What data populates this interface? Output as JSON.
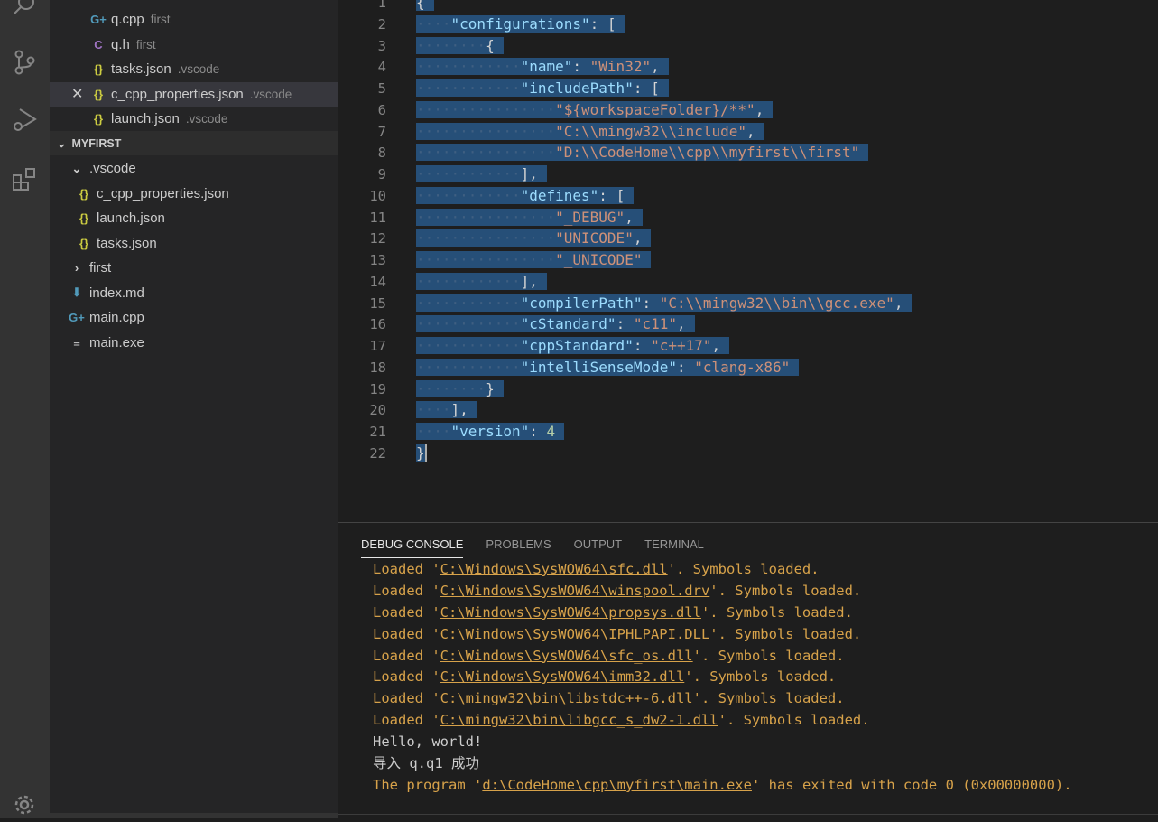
{
  "sidebar": {
    "open_editors": [
      {
        "name": "q.cpp",
        "desc": "first",
        "icon": "cpp-icon"
      },
      {
        "name": "q.h",
        "desc": "first",
        "icon": "c-header-icon"
      },
      {
        "name": "tasks.json",
        "desc": ".vscode",
        "icon": "json-icon"
      },
      {
        "name": "c_cpp_properties.json",
        "desc": ".vscode",
        "icon": "json-icon",
        "active": true
      },
      {
        "name": "launch.json",
        "desc": ".vscode",
        "icon": "json-icon"
      }
    ],
    "folder_title": "MYFIRST",
    "tree": [
      {
        "name": ".vscode",
        "type": "folder-open"
      },
      {
        "name": "c_cpp_properties.json",
        "type": "json"
      },
      {
        "name": "launch.json",
        "type": "json"
      },
      {
        "name": "tasks.json",
        "type": "json"
      },
      {
        "name": "first",
        "type": "folder-closed"
      },
      {
        "name": "index.md",
        "type": "markdown"
      },
      {
        "name": "main.cpp",
        "type": "cpp"
      },
      {
        "name": "main.exe",
        "type": "file"
      }
    ]
  },
  "editor": {
    "lines": [
      {
        "n": "1",
        "i": 0,
        "t": [
          [
            "p",
            "{"
          ]
        ]
      },
      {
        "n": "2",
        "i": 4,
        "t": [
          [
            "k",
            "\"configurations\""
          ],
          [
            "p",
            ": ["
          ]
        ]
      },
      {
        "n": "3",
        "i": 8,
        "t": [
          [
            "p",
            "{"
          ]
        ]
      },
      {
        "n": "4",
        "i": 12,
        "t": [
          [
            "k",
            "\"name\""
          ],
          [
            "p",
            ": "
          ],
          [
            "s",
            "\"Win32\""
          ],
          [
            "p",
            ","
          ]
        ]
      },
      {
        "n": "5",
        "i": 12,
        "t": [
          [
            "k",
            "\"includePath\""
          ],
          [
            "p",
            ": ["
          ]
        ]
      },
      {
        "n": "6",
        "i": 16,
        "t": [
          [
            "s",
            "\"${workspaceFolder}/**\""
          ],
          [
            "p",
            ","
          ]
        ]
      },
      {
        "n": "7",
        "i": 16,
        "t": [
          [
            "s",
            "\"C:\\\\mingw32\\\\include\""
          ],
          [
            "p",
            ","
          ]
        ]
      },
      {
        "n": "8",
        "i": 16,
        "t": [
          [
            "s",
            "\"D:\\\\CodeHome\\\\cpp\\\\myfirst\\\\first\""
          ]
        ]
      },
      {
        "n": "9",
        "i": 12,
        "t": [
          [
            "p",
            "],"
          ]
        ]
      },
      {
        "n": "10",
        "i": 12,
        "t": [
          [
            "k",
            "\"defines\""
          ],
          [
            "p",
            ": ["
          ]
        ]
      },
      {
        "n": "11",
        "i": 16,
        "t": [
          [
            "s",
            "\"_DEBUG\""
          ],
          [
            "p",
            ","
          ]
        ]
      },
      {
        "n": "12",
        "i": 16,
        "t": [
          [
            "s",
            "\"UNICODE\""
          ],
          [
            "p",
            ","
          ]
        ]
      },
      {
        "n": "13",
        "i": 16,
        "t": [
          [
            "s",
            "\"_UNICODE\""
          ]
        ]
      },
      {
        "n": "14",
        "i": 12,
        "t": [
          [
            "p",
            "],"
          ]
        ]
      },
      {
        "n": "15",
        "i": 12,
        "t": [
          [
            "k",
            "\"compilerPath\""
          ],
          [
            "p",
            ": "
          ],
          [
            "s",
            "\"C:\\\\mingw32\\\\bin\\\\gcc.exe\""
          ],
          [
            "p",
            ","
          ]
        ]
      },
      {
        "n": "16",
        "i": 12,
        "t": [
          [
            "k",
            "\"cStandard\""
          ],
          [
            "p",
            ": "
          ],
          [
            "s",
            "\"c11\""
          ],
          [
            "p",
            ","
          ]
        ]
      },
      {
        "n": "17",
        "i": 12,
        "t": [
          [
            "k",
            "\"cppStandard\""
          ],
          [
            "p",
            ": "
          ],
          [
            "s",
            "\"c++17\""
          ],
          [
            "p",
            ","
          ]
        ]
      },
      {
        "n": "18",
        "i": 12,
        "t": [
          [
            "k",
            "\"intelliSenseMode\""
          ],
          [
            "p",
            ": "
          ],
          [
            "s",
            "\"clang-x86\""
          ]
        ]
      },
      {
        "n": "19",
        "i": 8,
        "t": [
          [
            "p",
            "}"
          ]
        ]
      },
      {
        "n": "20",
        "i": 4,
        "t": [
          [
            "p",
            "],"
          ]
        ]
      },
      {
        "n": "21",
        "i": 4,
        "t": [
          [
            "k",
            "\"version\""
          ],
          [
            "p",
            ": "
          ],
          [
            "n",
            "4"
          ]
        ]
      },
      {
        "n": "22",
        "i": 0,
        "t": [
          [
            "p",
            "}"
          ]
        ]
      }
    ]
  },
  "panel": {
    "tabs": [
      "DEBUG CONSOLE",
      "PROBLEMS",
      "OUTPUT",
      "TERMINAL"
    ],
    "console": [
      {
        "c": "y",
        "parts": [
          "Loaded '",
          "C:\\Windows\\SysWOW64\\sfc.dll",
          "'. Symbols loaded."
        ],
        "link": true
      },
      {
        "c": "y",
        "parts": [
          "Loaded '",
          "C:\\Windows\\SysWOW64\\winspool.drv",
          "'. Symbols loaded."
        ],
        "link": true
      },
      {
        "c": "y",
        "parts": [
          "Loaded '",
          "C:\\Windows\\SysWOW64\\propsys.dll",
          "'. Symbols loaded."
        ],
        "link": true
      },
      {
        "c": "y",
        "parts": [
          "Loaded '",
          "C:\\Windows\\SysWOW64\\IPHLPAPI.DLL",
          "'. Symbols loaded."
        ],
        "link": true
      },
      {
        "c": "y",
        "parts": [
          "Loaded '",
          "C:\\Windows\\SysWOW64\\sfc_os.dll",
          "'. Symbols loaded."
        ],
        "link": true
      },
      {
        "c": "y",
        "parts": [
          "Loaded '",
          "C:\\Windows\\SysWOW64\\imm32.dll",
          "'. Symbols loaded."
        ],
        "link": true
      },
      {
        "c": "y",
        "parts": [
          "Loaded '",
          "C:\\mingw32\\bin\\libstdc++-6.dll",
          "'. Symbols loaded."
        ],
        "link": false
      },
      {
        "c": "y",
        "parts": [
          "Loaded '",
          "C:\\mingw32\\bin\\libgcc_s_dw2-1.dll",
          "'. Symbols loaded."
        ],
        "link": true
      },
      {
        "c": "w",
        "parts": [
          "Hello, world!",
          "",
          ""
        ],
        "link": false
      },
      {
        "c": "w",
        "parts": [
          "导入 q.q1 成功",
          "",
          ""
        ],
        "link": false
      },
      {
        "c": "y",
        "parts": [
          "The program '",
          "d:\\CodeHome\\cpp\\myfirst\\main.exe",
          "' has exited with code 0 (0x00000000)."
        ],
        "link": true
      }
    ]
  },
  "colors": {
    "selection": "#264f78",
    "key": "#9cdcfe",
    "string": "#ce9178",
    "console_info": "#d7a24a"
  }
}
